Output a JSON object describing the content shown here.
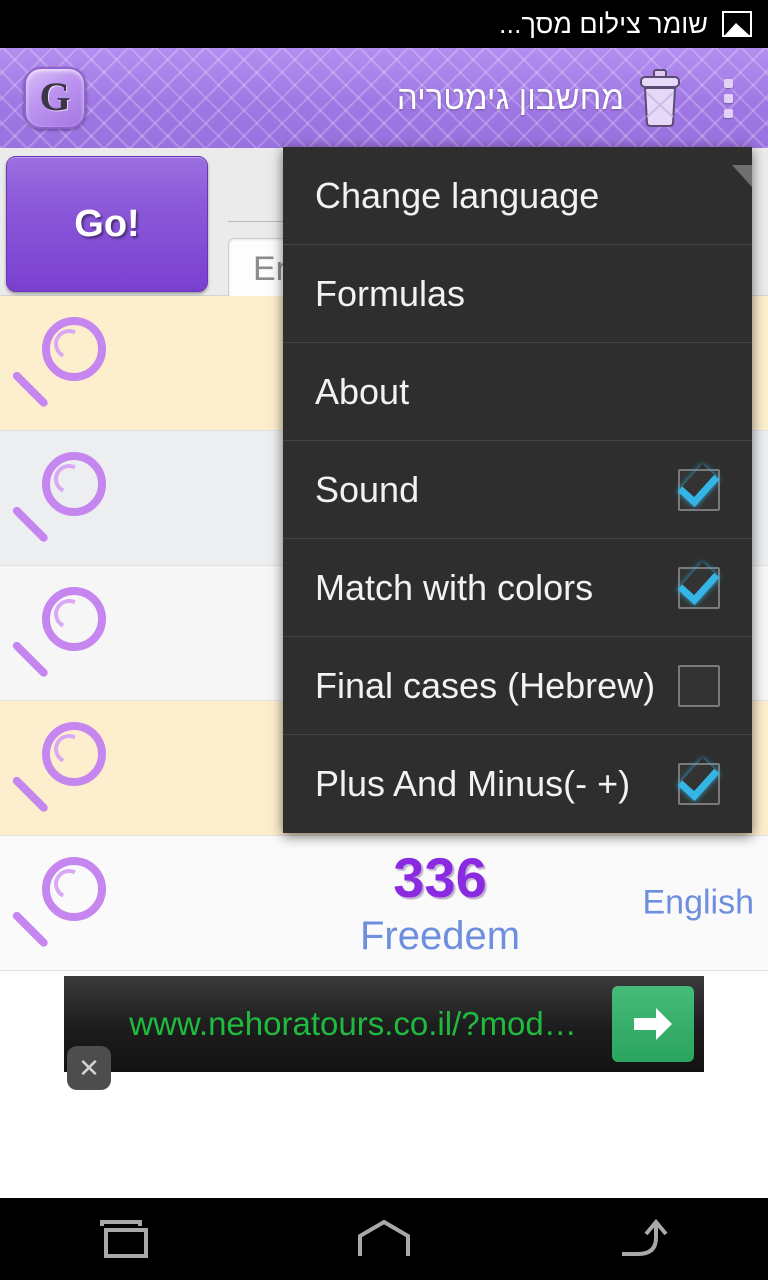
{
  "status_bar": {
    "text": "שומר צילום מסך...",
    "icon": "image-icon"
  },
  "action_bar": {
    "app_icon_letter": "G",
    "title": "מחשבון גימטריה",
    "delete_icon": "trash-icon",
    "overflow_icon": "overflow-dots-icon"
  },
  "input_row": {
    "go_label": "Go!",
    "language_selected": "En",
    "input_placeholder": "En"
  },
  "results": [
    {
      "value": "",
      "word": "",
      "lang": "",
      "shade": "cream"
    },
    {
      "value": "",
      "word": "",
      "lang": "",
      "shade": "gray"
    },
    {
      "value": "",
      "word": "",
      "lang": "",
      "shade": "light"
    },
    {
      "value": "",
      "word": "",
      "lang": "",
      "shade": "cream"
    },
    {
      "value": "336",
      "word": "Freedem",
      "lang": "English",
      "shade": "white"
    }
  ],
  "ad": {
    "url": "www.nehoratours.co.il/?mod…",
    "cta_icon": "arrow-right-icon",
    "close_label": "✕",
    "url_color": "#1fbb3f",
    "cta_color": "#2aa45f"
  },
  "overflow_menu": {
    "items": [
      {
        "label": "Change language",
        "has_checkbox": false,
        "checked": false
      },
      {
        "label": "Formulas",
        "has_checkbox": false,
        "checked": false
      },
      {
        "label": "About",
        "has_checkbox": false,
        "checked": false
      },
      {
        "label": "Sound",
        "has_checkbox": true,
        "checked": true
      },
      {
        "label": "Match with colors",
        "has_checkbox": true,
        "checked": true
      },
      {
        "label": "Final cases (Hebrew)",
        "has_checkbox": true,
        "checked": false
      },
      {
        "label": "Plus And Minus(- +)",
        "has_checkbox": true,
        "checked": true
      }
    ],
    "background": "#2e2e2e",
    "checkbox_accent": "#33b5e5"
  },
  "nav_bar": {
    "buttons": [
      {
        "name": "recents-icon"
      },
      {
        "name": "home-icon"
      },
      {
        "name": "back-icon"
      }
    ]
  },
  "theme": {
    "action_bar_purple": "#a078e4",
    "go_button_purple": "#7a3fd0",
    "value_purple": "#8a2be2",
    "word_blue": "#6e8ede",
    "row_cream": "#fdeecd",
    "row_gray": "#eceef0"
  }
}
